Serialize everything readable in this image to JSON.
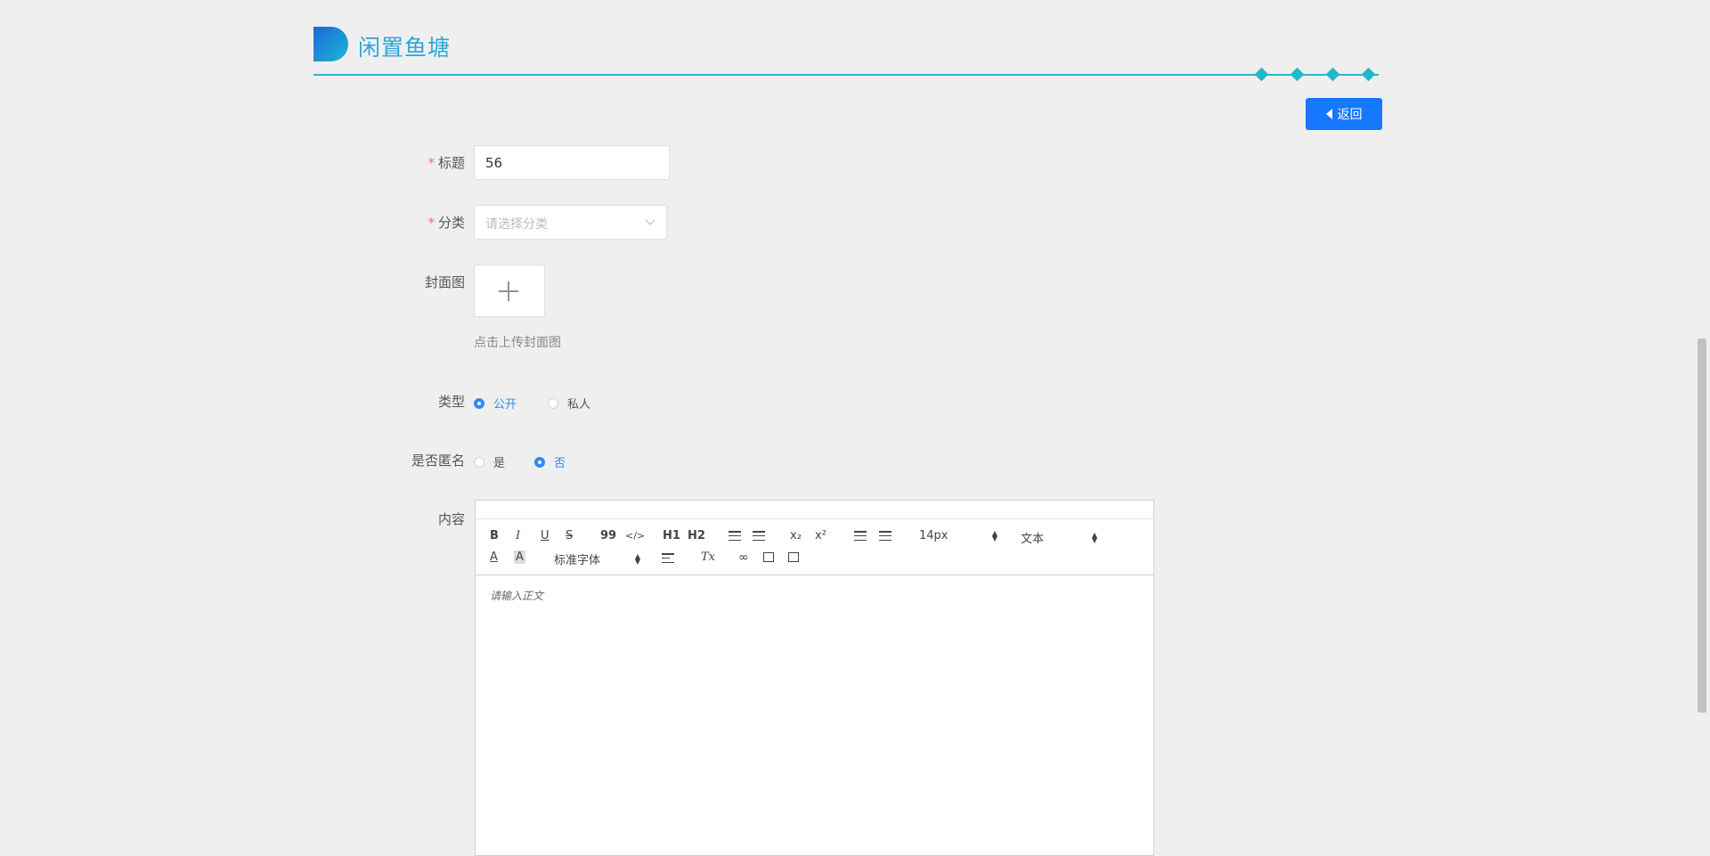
{
  "header": {
    "title": "闲置鱼塘"
  },
  "back_button": {
    "label": "返回"
  },
  "form": {
    "title": {
      "label": "标题",
      "required_mark": "*",
      "value": "56"
    },
    "category": {
      "label": "分类",
      "required_mark": "*",
      "placeholder": "请选择分类"
    },
    "cover": {
      "label": "封面图",
      "hint": "点击上传封面图"
    },
    "type": {
      "label": "类型",
      "options": [
        "公开",
        "私人"
      ],
      "selected": "公开"
    },
    "anonymous": {
      "label": "是否匿名",
      "options": [
        "是",
        "否"
      ],
      "selected": "否"
    },
    "content": {
      "label": "内容",
      "placeholder": "请输入正文",
      "toolbar": {
        "bold": "B",
        "italic": "I",
        "underline": "U",
        "strike": "S",
        "blockquote": "99",
        "code": "</>",
        "h1": "H1",
        "h2": "H2",
        "sub": "x₂",
        "sup": "x²",
        "size": "14px",
        "header": "文本",
        "font": "标准字体",
        "color": "A",
        "background": "A",
        "clean": "Tx"
      }
    }
  },
  "colors": {
    "accent": "#22b8c8",
    "primary": "#1677ff",
    "radio": "#2d8cf0"
  }
}
